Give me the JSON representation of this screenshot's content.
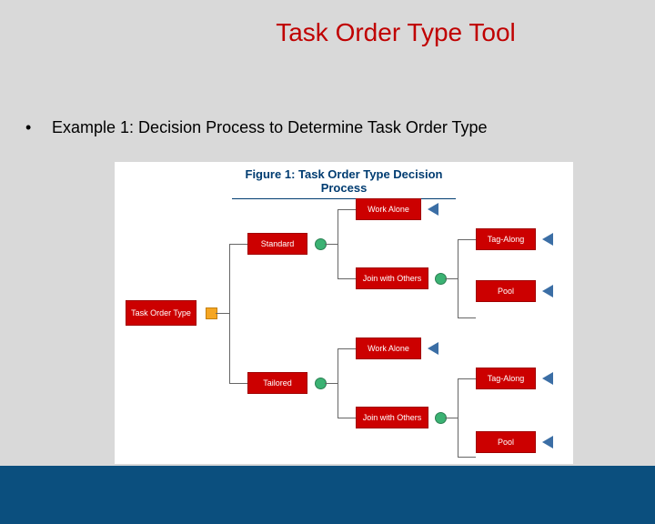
{
  "title": "Task Order Type Tool",
  "bullet": {
    "marker": "•",
    "text": "Example 1: Decision Process to Determine Task Order Type"
  },
  "figure": {
    "title": "Figure 1: Task Order Type Decision Process",
    "root": "Task Order Type",
    "branches": [
      {
        "label": "Standard",
        "options": [
          "Work Alone",
          "Join with Others"
        ],
        "outcomes": [
          "Tag-Along",
          "Pool"
        ]
      },
      {
        "label": "Tailored",
        "options": [
          "Work Alone",
          "Join with Others"
        ],
        "outcomes": [
          "Tag-Along",
          "Pool"
        ]
      }
    ]
  },
  "chart_data": {
    "type": "tree",
    "root": "Task Order Type",
    "children": [
      {
        "name": "Standard",
        "children": [
          {
            "name": "Work Alone"
          },
          {
            "name": "Join with Others",
            "children": [
              {
                "name": "Tag-Along"
              },
              {
                "name": "Pool"
              }
            ]
          }
        ]
      },
      {
        "name": "Tailored",
        "children": [
          {
            "name": "Work Alone"
          },
          {
            "name": "Join with Others",
            "children": [
              {
                "name": "Tag-Along"
              },
              {
                "name": "Pool"
              }
            ]
          }
        ]
      }
    ]
  }
}
